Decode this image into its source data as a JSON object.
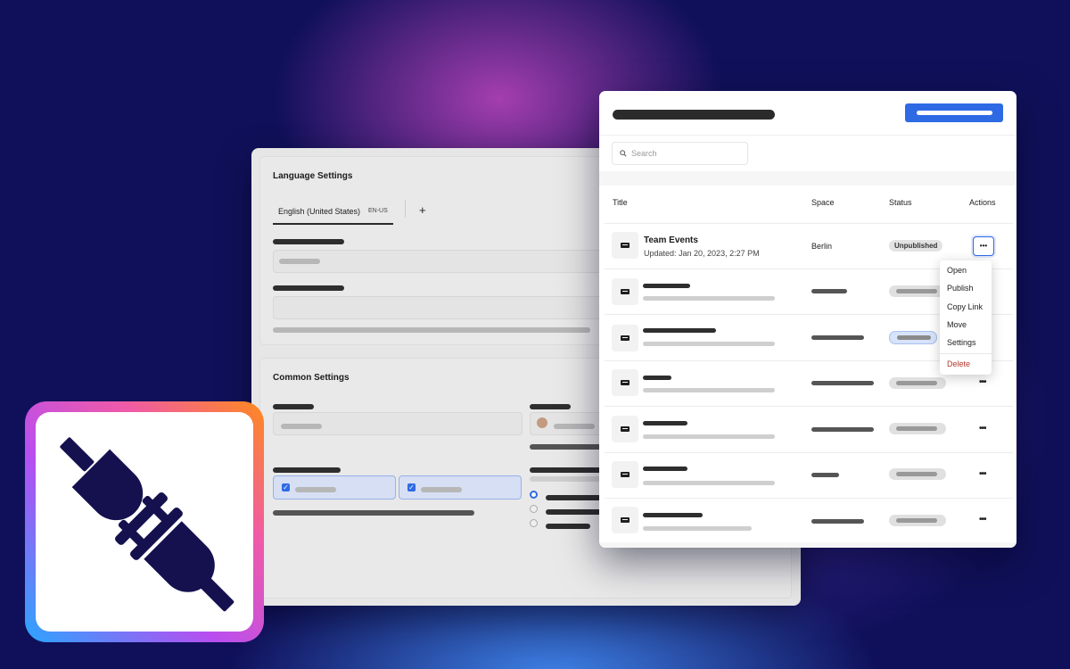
{
  "back_panel": {
    "language_settings": {
      "title": "Language Settings",
      "tab_label": "English (United States)",
      "tab_code": "EN-US",
      "add_symbol": "+"
    },
    "common_settings": {
      "title": "Common Settings"
    }
  },
  "front_panel": {
    "search_placeholder": "Search",
    "columns": [
      "Title",
      "Space",
      "Status",
      "Actions"
    ],
    "first_row": {
      "title": "Team Events",
      "updated": "Updated: Jan 20, 2023, 2:27 PM",
      "space": "Berlin",
      "status": "Unpublished"
    },
    "actions_symbol": "•••",
    "menu": {
      "items": [
        "Open",
        "Publish",
        "Copy Link",
        "Move",
        "Settings"
      ],
      "danger_item": "Delete"
    }
  },
  "colors": {
    "accent_blue": "#2f6ae5",
    "delete_red": "#b1362b",
    "background": "#10105a"
  },
  "icons": [
    "search-icon",
    "card-icon",
    "more-icon",
    "plug-icon",
    "add-icon"
  ]
}
